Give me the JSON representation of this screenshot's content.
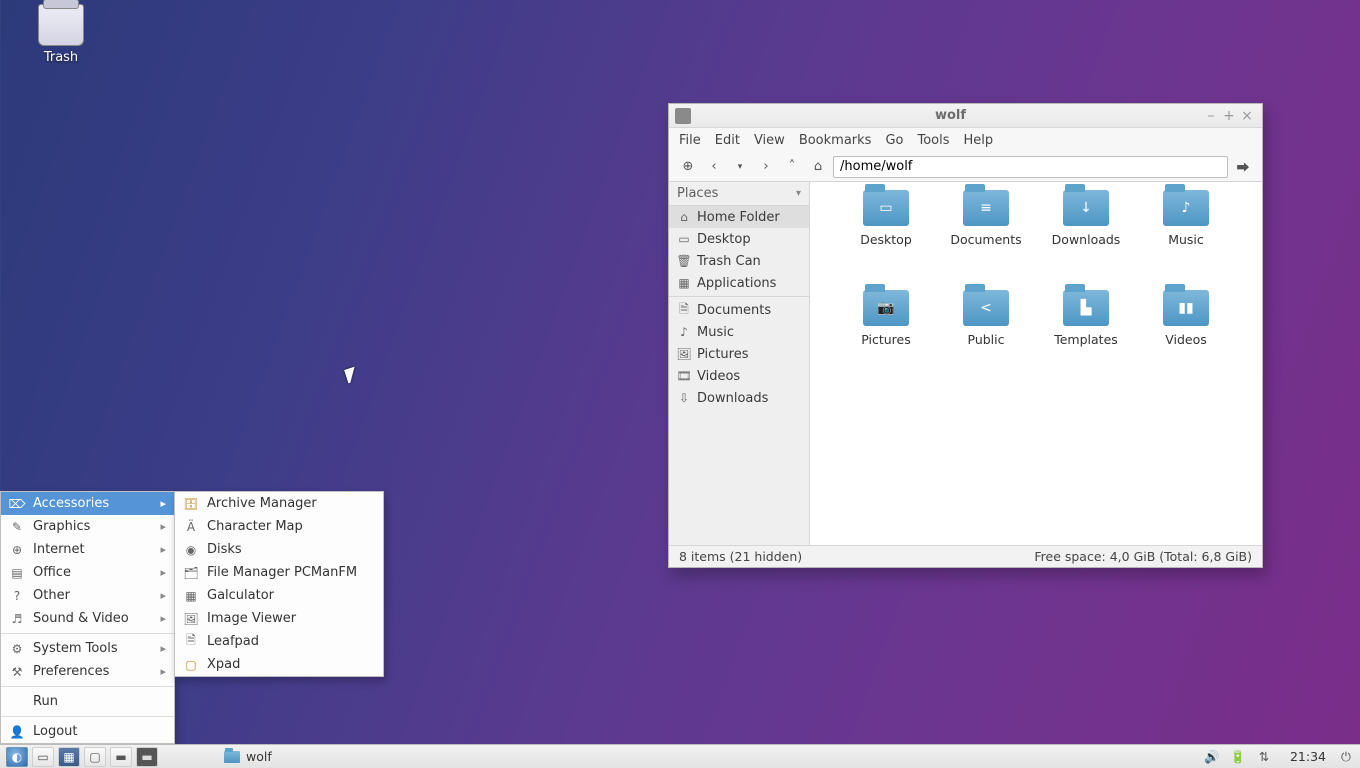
{
  "desktop": {
    "trash_label": "Trash"
  },
  "window": {
    "title": "wolf",
    "menus": {
      "file": "File",
      "edit": "Edit",
      "view": "View",
      "bookmarks": "Bookmarks",
      "go": "Go",
      "tools": "Tools",
      "help": "Help"
    },
    "path_value": "/home/wolf",
    "sidebar": {
      "header": "Places",
      "items": [
        {
          "label": "Home Folder",
          "active": true
        },
        {
          "label": "Desktop"
        },
        {
          "label": "Trash Can"
        },
        {
          "label": "Applications"
        },
        {
          "label": "Documents"
        },
        {
          "label": "Music"
        },
        {
          "label": "Pictures"
        },
        {
          "label": "Videos"
        },
        {
          "label": "Downloads"
        }
      ]
    },
    "folders": [
      {
        "label": "Desktop",
        "badge": "▭"
      },
      {
        "label": "Documents",
        "badge": "≡"
      },
      {
        "label": "Downloads",
        "badge": "↓"
      },
      {
        "label": "Music",
        "badge": "♪"
      },
      {
        "label": "Pictures",
        "badge": "📷"
      },
      {
        "label": "Public",
        "badge": "<"
      },
      {
        "label": "Templates",
        "badge": "▙"
      },
      {
        "label": "Videos",
        "badge": "▮▮"
      }
    ],
    "status_left": "8 items (21 hidden)",
    "status_right": "Free space: 4,0 GiB (Total: 6,8 GiB)"
  },
  "appmenu": {
    "primary": [
      {
        "label": "Accessories",
        "highlight": true
      },
      {
        "label": "Graphics"
      },
      {
        "label": "Internet"
      },
      {
        "label": "Office"
      },
      {
        "label": "Other"
      },
      {
        "label": "Sound & Video"
      },
      {
        "label": "System Tools"
      },
      {
        "label": "Preferences"
      }
    ],
    "extra": [
      {
        "label": "Run"
      },
      {
        "label": "Logout"
      }
    ],
    "sub": [
      {
        "label": "Archive Manager"
      },
      {
        "label": "Character Map"
      },
      {
        "label": "Disks"
      },
      {
        "label": "File Manager PCManFM"
      },
      {
        "label": "Galculator"
      },
      {
        "label": "Image Viewer"
      },
      {
        "label": "Leafpad"
      },
      {
        "label": "Xpad"
      }
    ]
  },
  "taskbar": {
    "active_task": "wolf",
    "clock": "21:34"
  }
}
